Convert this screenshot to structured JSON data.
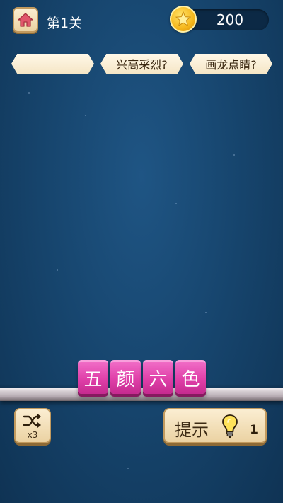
{
  "header": {
    "level_title": "第1关",
    "coin_count": "200"
  },
  "solved_idioms": [
    "",
    "兴高采烈?",
    "画龙点睛?"
  ],
  "tiles": [
    "五",
    "颜",
    "六",
    "色"
  ],
  "shuffle": {
    "count_label": "x3"
  },
  "hint": {
    "label": "提示",
    "count": "1"
  },
  "colors": {
    "background": "#17466f",
    "tile": "#df3fa8",
    "button_face": "#f5e3bf",
    "coin": "#f5b71b"
  },
  "icons": {
    "home": "home-icon",
    "coin": "star-coin-icon",
    "shuffle": "shuffle-icon",
    "hint": "lightbulb-icon"
  }
}
